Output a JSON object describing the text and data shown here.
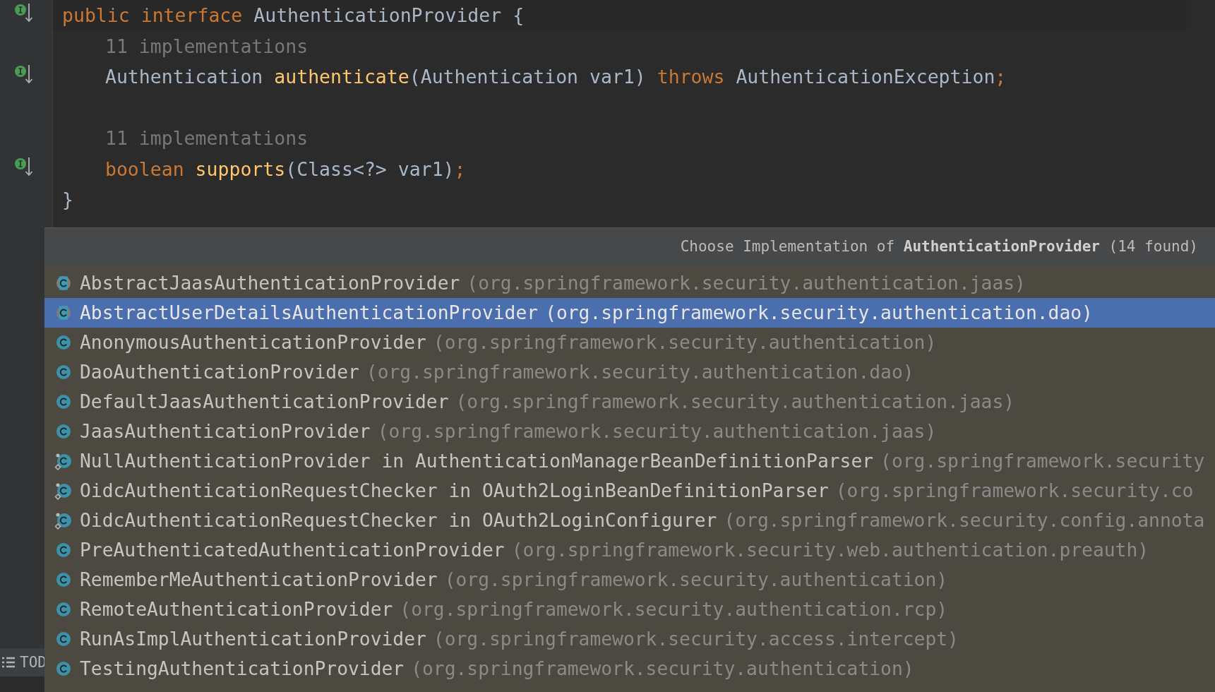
{
  "editor": {
    "lines": [
      {
        "kind": "code",
        "gutter_marker": true,
        "tokens": [
          {
            "text": "public interface ",
            "kind": "keyword"
          },
          {
            "text": "AuthenticationProvider {",
            "kind": "plain"
          }
        ],
        "children": [
          {
            "kind": "code",
            "gutter_marker": false,
            "tokens": [
              {
                "text": "11 implementations",
                "kind": "hint"
              }
            ]
          },
          {
            "kind": "code",
            "gutter_marker": true,
            "tokens": [
              {
                "text": "Authentication ",
                "kind": "plain"
              },
              {
                "text": "authenticate",
                "kind": "method"
              },
              {
                "text": "(Authentication var1) ",
                "kind": "plain"
              },
              {
                "text": "throws ",
                "kind": "keyword"
              },
              {
                "text": "AuthenticationException",
                "kind": "plain"
              },
              {
                "text": ";",
                "kind": "keyword"
              }
            ]
          },
          {
            "kind": "blank"
          },
          {
            "kind": "code",
            "gutter_marker": false,
            "tokens": [
              {
                "text": "11 implementations",
                "kind": "hint"
              }
            ]
          },
          {
            "kind": "code",
            "gutter_marker": true,
            "tokens": [
              {
                "text": "boolean ",
                "kind": "keyword"
              },
              {
                "text": "supports",
                "kind": "method"
              },
              {
                "text": "(Class<?> var1)",
                "kind": "plain"
              },
              {
                "text": ";",
                "kind": "keyword"
              }
            ]
          }
        ]
      },
      {
        "kind": "code",
        "gutter_marker": false,
        "tokens": [
          {
            "text": "}",
            "kind": "plain"
          }
        ]
      }
    ]
  },
  "tool_strip": {
    "label": "TOD"
  },
  "popup": {
    "title": "Choose Implementation of **AuthenticationProvider** (14 found)",
    "items": [
      {
        "kind": "abstract",
        "name": "AbstractJaasAuthenticationProvider",
        "package": "(org.springframework.security.authentication.jaas)",
        "selected": false
      },
      {
        "kind": "abstract",
        "name": "AbstractUserDetailsAuthenticationProvider",
        "package": "(org.springframework.security.authentication.dao)",
        "selected": true
      },
      {
        "kind": "class",
        "name": "AnonymousAuthenticationProvider",
        "package": "(org.springframework.security.authentication)",
        "selected": false
      },
      {
        "kind": "class",
        "name": "DaoAuthenticationProvider",
        "package": "(org.springframework.security.authentication.dao)",
        "selected": false
      },
      {
        "kind": "class",
        "name": "DefaultJaasAuthenticationProvider",
        "package": "(org.springframework.security.authentication.jaas)",
        "selected": false
      },
      {
        "kind": "class",
        "name": "JaasAuthenticationProvider",
        "package": "(org.springframework.security.authentication.jaas)",
        "selected": false
      },
      {
        "kind": "inner",
        "name": "NullAuthenticationProvider in AuthenticationManagerBeanDefinitionParser",
        "package": "(org.springframework.security",
        "selected": false
      },
      {
        "kind": "inner",
        "name": "OidcAuthenticationRequestChecker in OAuth2LoginBeanDefinitionParser",
        "package": "(org.springframework.security.co",
        "selected": false
      },
      {
        "kind": "inner",
        "name": "OidcAuthenticationRequestChecker in OAuth2LoginConfigurer",
        "package": "(org.springframework.security.config.annota",
        "selected": false
      },
      {
        "kind": "class",
        "name": "PreAuthenticatedAuthenticationProvider",
        "package": "(org.springframework.security.web.authentication.preauth)",
        "selected": false
      },
      {
        "kind": "class",
        "name": "RememberMeAuthenticationProvider",
        "package": "(org.springframework.security.authentication)",
        "selected": false
      },
      {
        "kind": "class",
        "name": "RemoteAuthenticationProvider",
        "package": "(org.springframework.security.authentication.rcp)",
        "selected": false
      },
      {
        "kind": "class",
        "name": "RunAsImplAuthenticationProvider",
        "package": "(org.springframework.security.access.intercept)",
        "selected": false
      },
      {
        "kind": "class",
        "name": "TestingAuthenticationProvider",
        "package": "(org.springframework.security.authentication)",
        "selected": false
      }
    ]
  }
}
